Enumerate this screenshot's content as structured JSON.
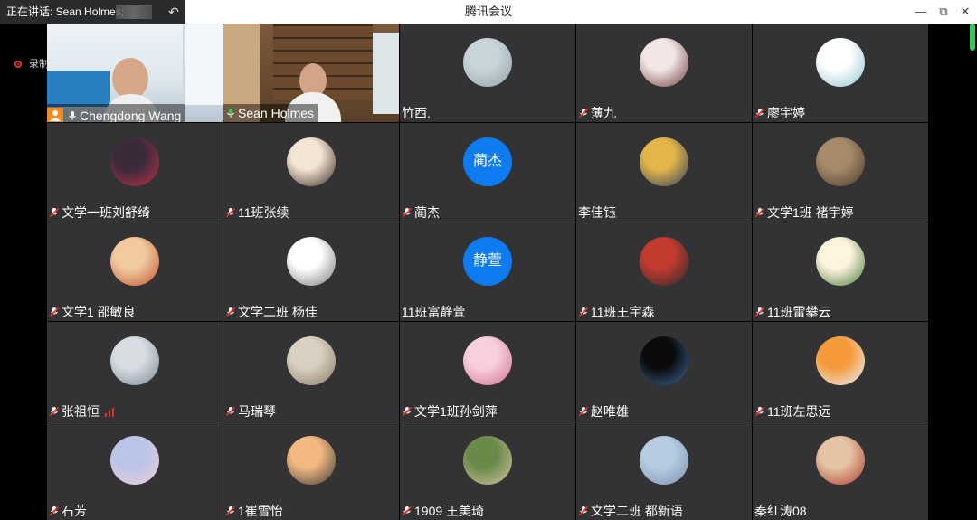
{
  "titlebar": {
    "speaking_label": "正在讲话: Sean Holmes;",
    "app_title": "腾讯会议",
    "back_icon": "undo-arrow-icon",
    "min": "—",
    "restore": "⧉",
    "close": "✕"
  },
  "recording": {
    "label": "录制中"
  },
  "colors": {
    "avatar_blue": "#0f7bf0",
    "host_orange": "#f38b1e",
    "active_green": "#1fbf6a",
    "tile_bg": "#333335"
  },
  "participants": [
    {
      "name": "Chengdong Wang",
      "type": "video",
      "mic": "on",
      "host": true
    },
    {
      "name": "Sean Holmes",
      "type": "video",
      "mic": "speaking",
      "active": true
    },
    {
      "name": "竹西.",
      "type": "image",
      "mic": "none",
      "c1": "#c9d4d8",
      "c2": "#8fa2a8"
    },
    {
      "name": "薄九",
      "type": "image",
      "mic": "muted",
      "c1": "#f3e6e6",
      "c2": "#6b3c3c"
    },
    {
      "name": "廖宇婷",
      "type": "image",
      "mic": "muted",
      "c1": "#ffffff",
      "c2": "#8ec4cf"
    },
    {
      "name": "文学一班刘舒绮",
      "type": "image",
      "mic": "muted",
      "c1": "#3a2a3a",
      "c2": "#c0304a"
    },
    {
      "name": "11班张续",
      "type": "image",
      "mic": "muted",
      "c1": "#f3e4d4",
      "c2": "#3b2b22"
    },
    {
      "name": "蔺杰",
      "type": "text",
      "text": "蔺杰",
      "mic": "muted"
    },
    {
      "name": "李佳钰",
      "type": "image",
      "mic": "none",
      "c1": "#e4b54a",
      "c2": "#2c3f5c"
    },
    {
      "name": "文学1班 褚宇婷",
      "type": "image",
      "mic": "muted",
      "c1": "#a68a6a",
      "c2": "#4a3a2a"
    },
    {
      "name": "文学1 邵敏良",
      "type": "image",
      "mic": "muted",
      "c1": "#f2c9a0",
      "c2": "#c2542d"
    },
    {
      "name": "文学二班 杨佳",
      "type": "image",
      "mic": "muted",
      "c1": "#ffffff",
      "c2": "#777777"
    },
    {
      "name": "11班富静萱",
      "type": "text",
      "text": "静萱",
      "mic": "none"
    },
    {
      "name": "11班王宇森",
      "type": "image",
      "mic": "muted",
      "c1": "#c23b2f",
      "c2": "#2a2a2a"
    },
    {
      "name": "11班雷攀云",
      "type": "image",
      "mic": "muted",
      "c1": "#fff4e0",
      "c2": "#4a7a3a"
    },
    {
      "name": "张祖恒",
      "type": "image",
      "mic": "muted",
      "signal": true,
      "c1": "#d8dde2",
      "c2": "#7a8894"
    },
    {
      "name": "马瑞琴",
      "type": "image",
      "mic": "muted",
      "c1": "#d8d0c0",
      "c2": "#8a7a66"
    },
    {
      "name": "文学1班孙剑萍",
      "type": "image",
      "mic": "muted",
      "c1": "#f7d0dc",
      "c2": "#d2708e"
    },
    {
      "name": "赵唯雄",
      "type": "image",
      "mic": "muted",
      "c1": "#0a0a0a",
      "c2": "#3d6a9a"
    },
    {
      "name": "11班左思远",
      "type": "image",
      "mic": "muted",
      "c1": "#f59a3a",
      "c2": "#e6f4ff"
    },
    {
      "name": "石芳",
      "type": "image",
      "mic": "muted",
      "c1": "#b9c4e8",
      "c2": "#f0d0d6"
    },
    {
      "name": "1崔雪怡",
      "type": "image",
      "mic": "muted",
      "c1": "#f2b880",
      "c2": "#3a3a3a"
    },
    {
      "name": "1909 王美琦",
      "type": "image",
      "mic": "muted",
      "c1": "#6a8a4a",
      "c2": "#d8c4a0"
    },
    {
      "name": "文学二班 都新语",
      "type": "image",
      "mic": "muted",
      "c1": "#b7cbe2",
      "c2": "#7a92b0"
    },
    {
      "name": "秦红涛08",
      "type": "image",
      "mic": "none",
      "c1": "#e4c4a4",
      "c2": "#b03a2e"
    }
  ]
}
